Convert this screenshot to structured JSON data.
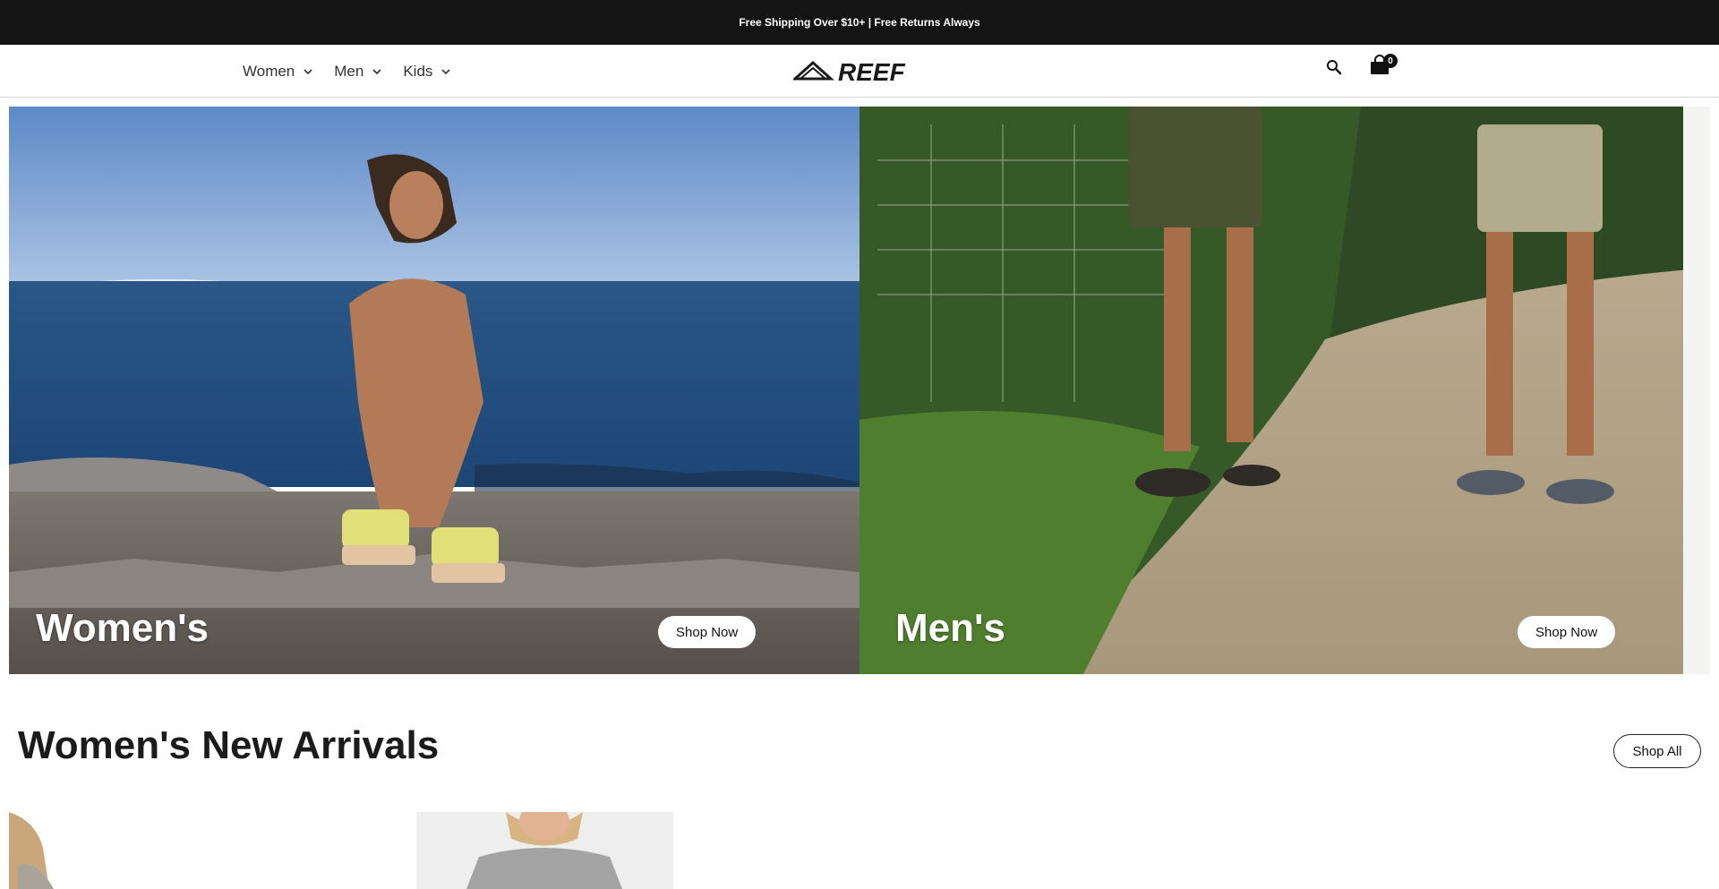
{
  "announcement": "Free Shipping Over $10+ | Free Returns Always",
  "nav": [
    {
      "label": "Women"
    },
    {
      "label": "Men"
    },
    {
      "label": "Kids"
    }
  ],
  "brand": {
    "logo_text": "REEF"
  },
  "icons": {
    "search": "search-icon",
    "cart": "shopping-bag-icon",
    "chevron": "chevron-down-icon"
  },
  "cart": {
    "count": "0"
  },
  "hero": {
    "womens": {
      "title": "Women's",
      "button": "Shop Now"
    },
    "mens": {
      "title": "Men's",
      "button": "Shop Now"
    }
  },
  "arrivals": {
    "title": "Women's New Arrivals",
    "button": "Shop All"
  },
  "colors": {
    "announcement_bg": "#141414",
    "text": "#111111",
    "border": "#d8d8d8"
  }
}
